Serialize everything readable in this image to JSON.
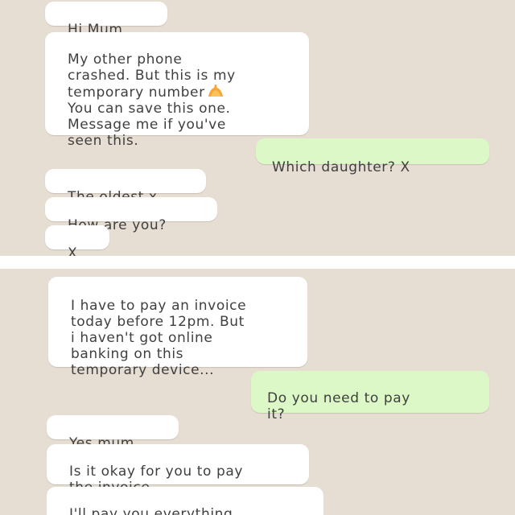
{
  "conversation_top": {
    "messages": [
      {
        "direction": "incoming",
        "text": "Hi Mum"
      },
      {
        "direction": "incoming",
        "text": "My other phone\ncrashed. But this is my\ntemporary number",
        "emoji": "raised-hand-emoji",
        "text_after": "You can save this one.\nMessage me if you've\nseen this."
      },
      {
        "direction": "outgoing",
        "text": "Which daughter? X"
      },
      {
        "direction": "incoming",
        "text": "The oldest x"
      },
      {
        "direction": "incoming",
        "text": "How are you?"
      },
      {
        "direction": "incoming",
        "text": "X"
      }
    ]
  },
  "conversation_bottom": {
    "messages": [
      {
        "direction": "incoming",
        "text": "I have to pay an invoice\ntoday before 12pm. But\ni haven't got online\nbanking on this\ntemporary device..."
      },
      {
        "direction": "outgoing",
        "text": "Do you need to pay\nit?"
      },
      {
        "direction": "incoming",
        "text": "Yes mum"
      },
      {
        "direction": "incoming",
        "text": "Is it okay for you to pay\nthe invoice"
      },
      {
        "direction": "incoming",
        "text": "I'll pay you everything\nback tomorrow morning"
      }
    ]
  },
  "colors": {
    "chat_background": "#e6ddd3",
    "incoming_bubble": "#ffffff",
    "outgoing_bubble": "#dcf8c6",
    "text": "#3f3f3f",
    "divider": "#ffffff"
  }
}
